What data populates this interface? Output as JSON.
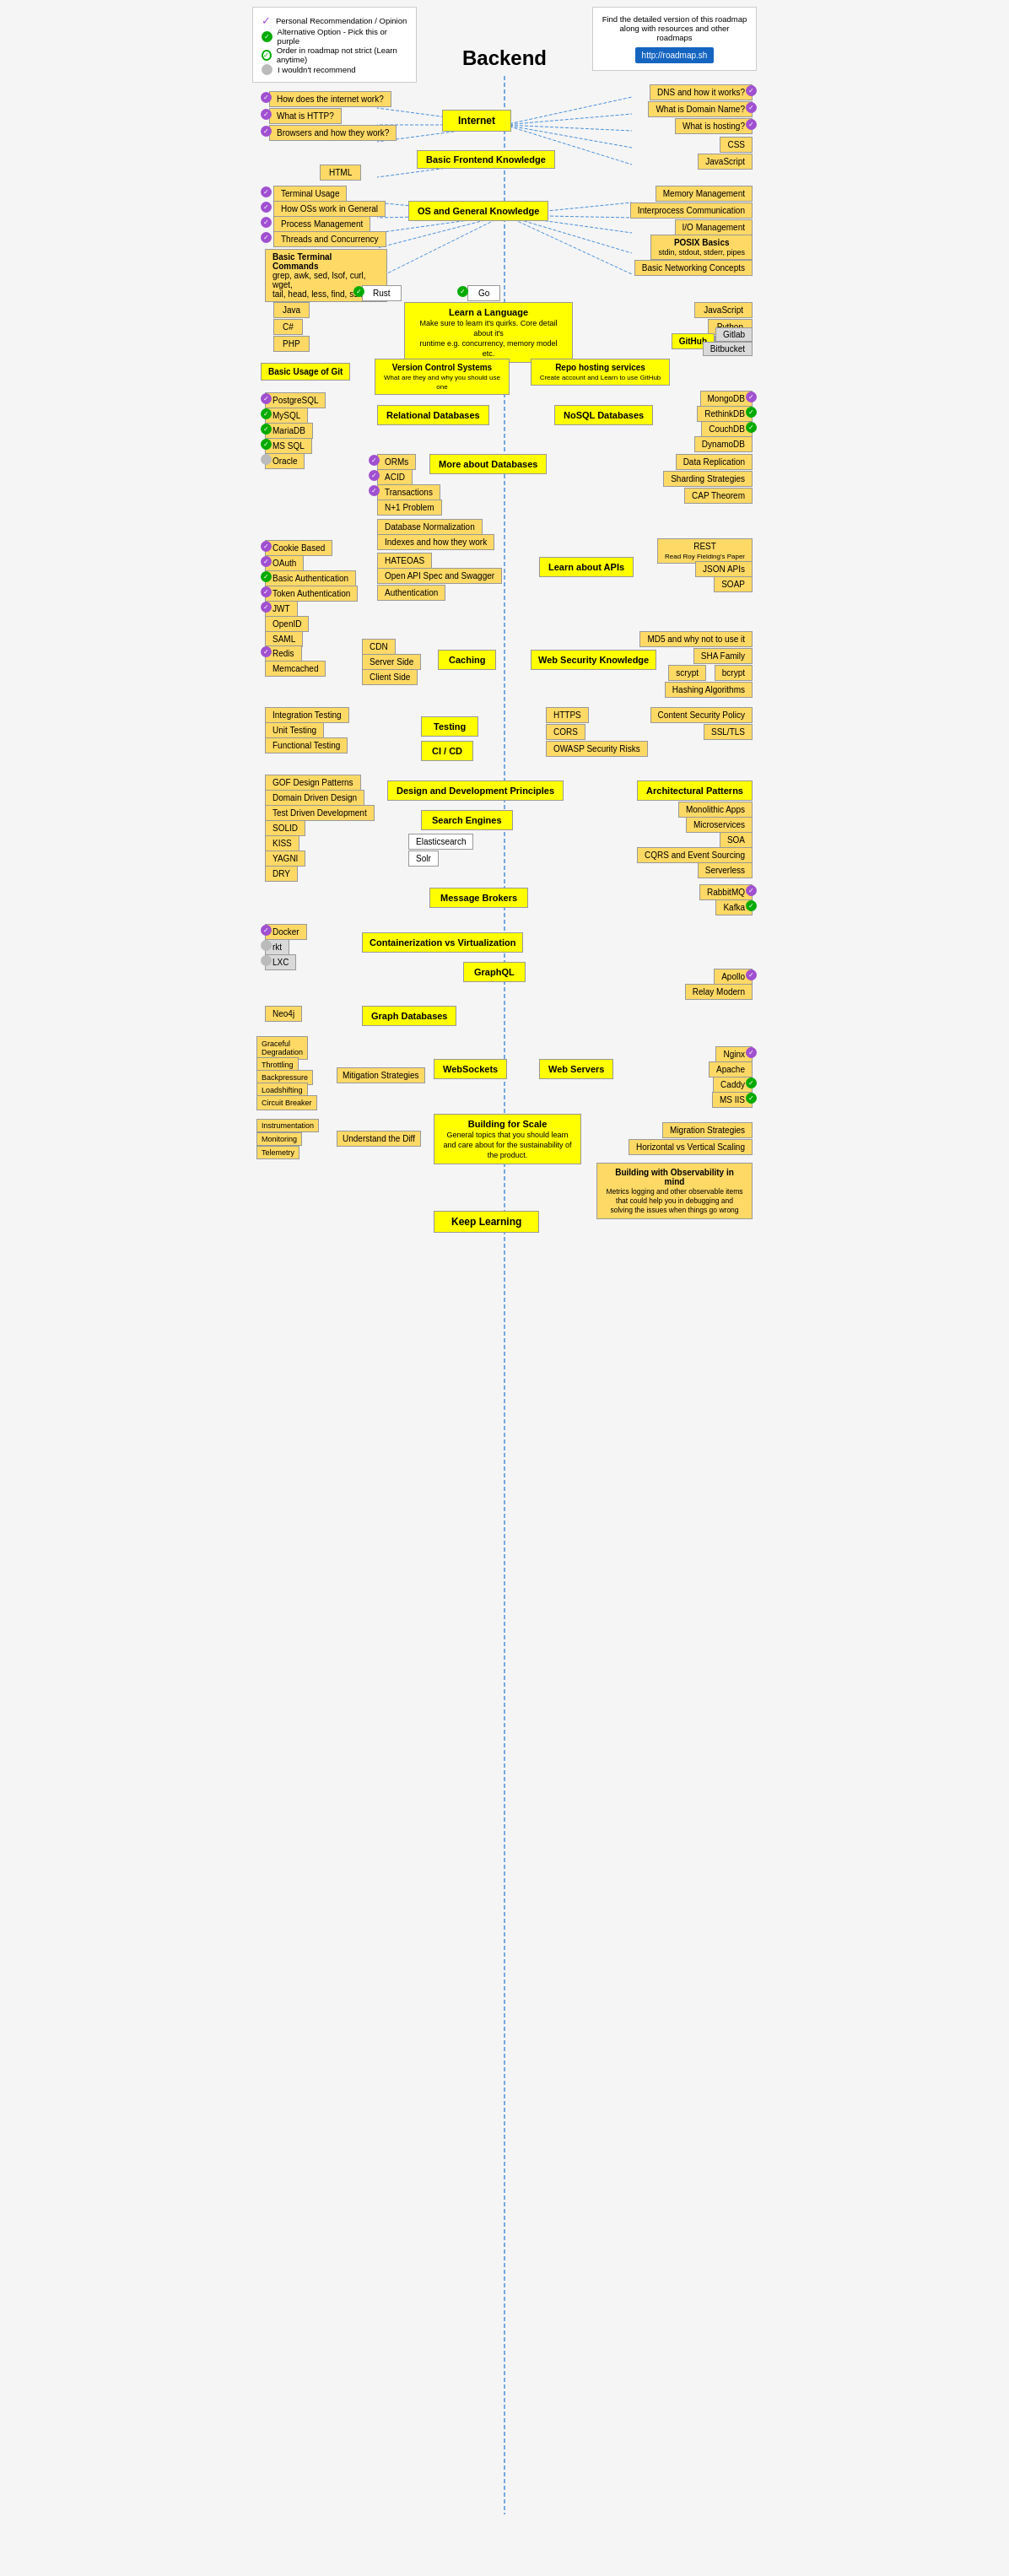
{
  "title": "Backend",
  "legend": {
    "items": [
      {
        "icon": "purple-check",
        "text": "Personal Recommendation / Opinion"
      },
      {
        "icon": "green-check",
        "text": "Alternative Option - Pick this or purple"
      },
      {
        "icon": "green-check-outline",
        "text": "Order in roadmap not strict (Learn anytime)"
      },
      {
        "icon": "gray-dot",
        "text": "I wouldn't recommend"
      }
    ]
  },
  "info": {
    "line1": "Find the detailed version of this roadmap",
    "line2": "along with resources and other roadmaps",
    "url": "http://roadmap.sh"
  },
  "nodes": {
    "internet": "Internet",
    "basicFrontend": "Basic Frontend Knowledge",
    "osGeneral": "OS and General Knowledge",
    "learnLanguage": "Learn a Language",
    "vcs": "Version Control Systems\nWhat are they and why you should use one",
    "repoHosting": "Repo hosting services\nCreate account and Learn to use GitHub",
    "relationalDB": "Relational Databases",
    "nosqlDB": "NoSQL Databases",
    "moreDB": "More about Databases",
    "learnAPIs": "Learn about APIs",
    "caching": "Caching",
    "webSecurity": "Web Security Knowledge",
    "testing": "Testing",
    "cicd": "CI / CD",
    "designPrinciples": "Design and Development Principles",
    "searchEngines": "Search Engines",
    "archPatterns": "Architectural Patterns",
    "messageBrokers": "Message Brokers",
    "containerization": "Containerization vs Virtualization",
    "graphql": "GraphQL",
    "graphDB": "Graph Databases",
    "websockets": "WebSockets",
    "webServers": "Web Servers",
    "buildingScale": "Building for Scale\nGeneral topics that you should learn and care about for the sustainability of the product.",
    "keepLearning": "Keep Learning",
    "understandDiff": "Understand the Diff"
  }
}
